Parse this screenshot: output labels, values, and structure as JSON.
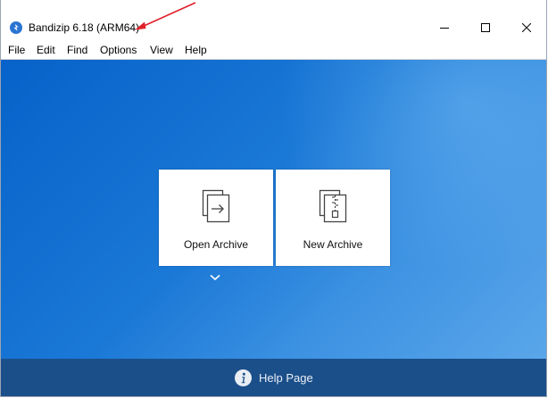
{
  "window": {
    "title": "Bandizip 6.18 (ARM64)",
    "app_icon": "bandizip-logo-icon",
    "controls": [
      "minimize-icon",
      "maximize-icon",
      "close-icon"
    ]
  },
  "menu": {
    "items": [
      {
        "label": "File"
      },
      {
        "label": "Edit"
      },
      {
        "label": "Find"
      },
      {
        "label": "Options"
      },
      {
        "label": "View"
      },
      {
        "label": "Help"
      }
    ]
  },
  "main": {
    "tiles": [
      {
        "label": "Open Archive",
        "icon": "open-archive-icon"
      },
      {
        "label": "New Archive",
        "icon": "new-archive-icon"
      }
    ],
    "dropdown_icon": "chevron-down-icon"
  },
  "footer": {
    "help_label": "Help Page",
    "help_icon": "info-icon"
  },
  "annotation": {
    "arrow_color": "#e0202a"
  },
  "colors": {
    "content_blue": "#1a78d6",
    "footer_blue": "#1b4f8a",
    "accent": "#2a74d2"
  }
}
